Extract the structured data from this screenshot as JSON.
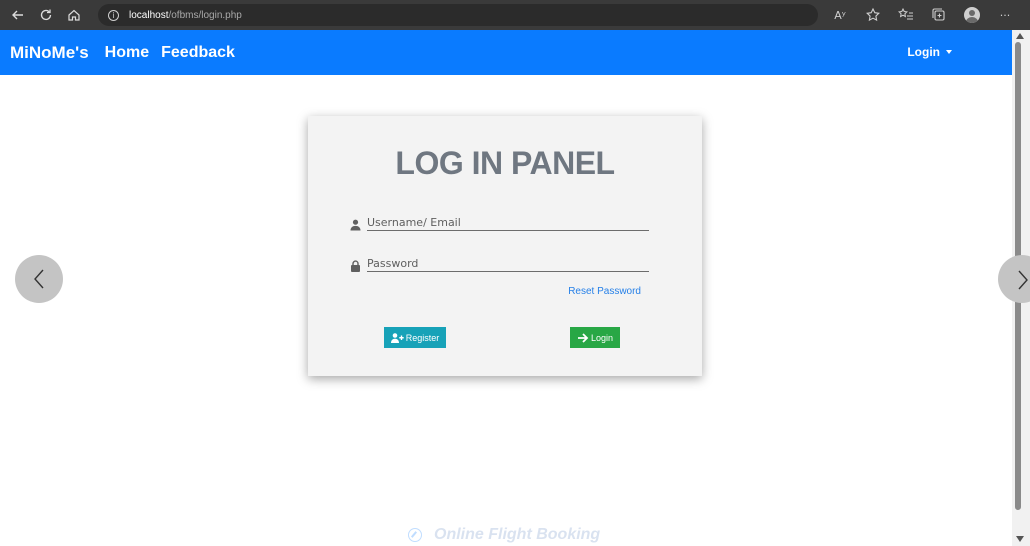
{
  "browser": {
    "url_host": "localhost",
    "url_path": "/ofbms/login.php",
    "info_symbol": "i",
    "read_aloud_label": "Aʸ",
    "more_label": "···"
  },
  "navbar": {
    "brand": "MiNoMe's",
    "links": [
      "Home",
      "Feedback"
    ],
    "login_dropdown": "Login",
    "color": "#0a7bff"
  },
  "panel": {
    "title": "LOG IN PANEL",
    "username_placeholder": "Username/ Email",
    "password_placeholder": "Password",
    "reset_link": "Reset Password",
    "register_button": "Register",
    "login_button": "Login"
  },
  "footer": {
    "text": "Online Flight Booking"
  },
  "colors": {
    "register": "#17a2b8",
    "login": "#28a745",
    "link": "#2680e8"
  }
}
